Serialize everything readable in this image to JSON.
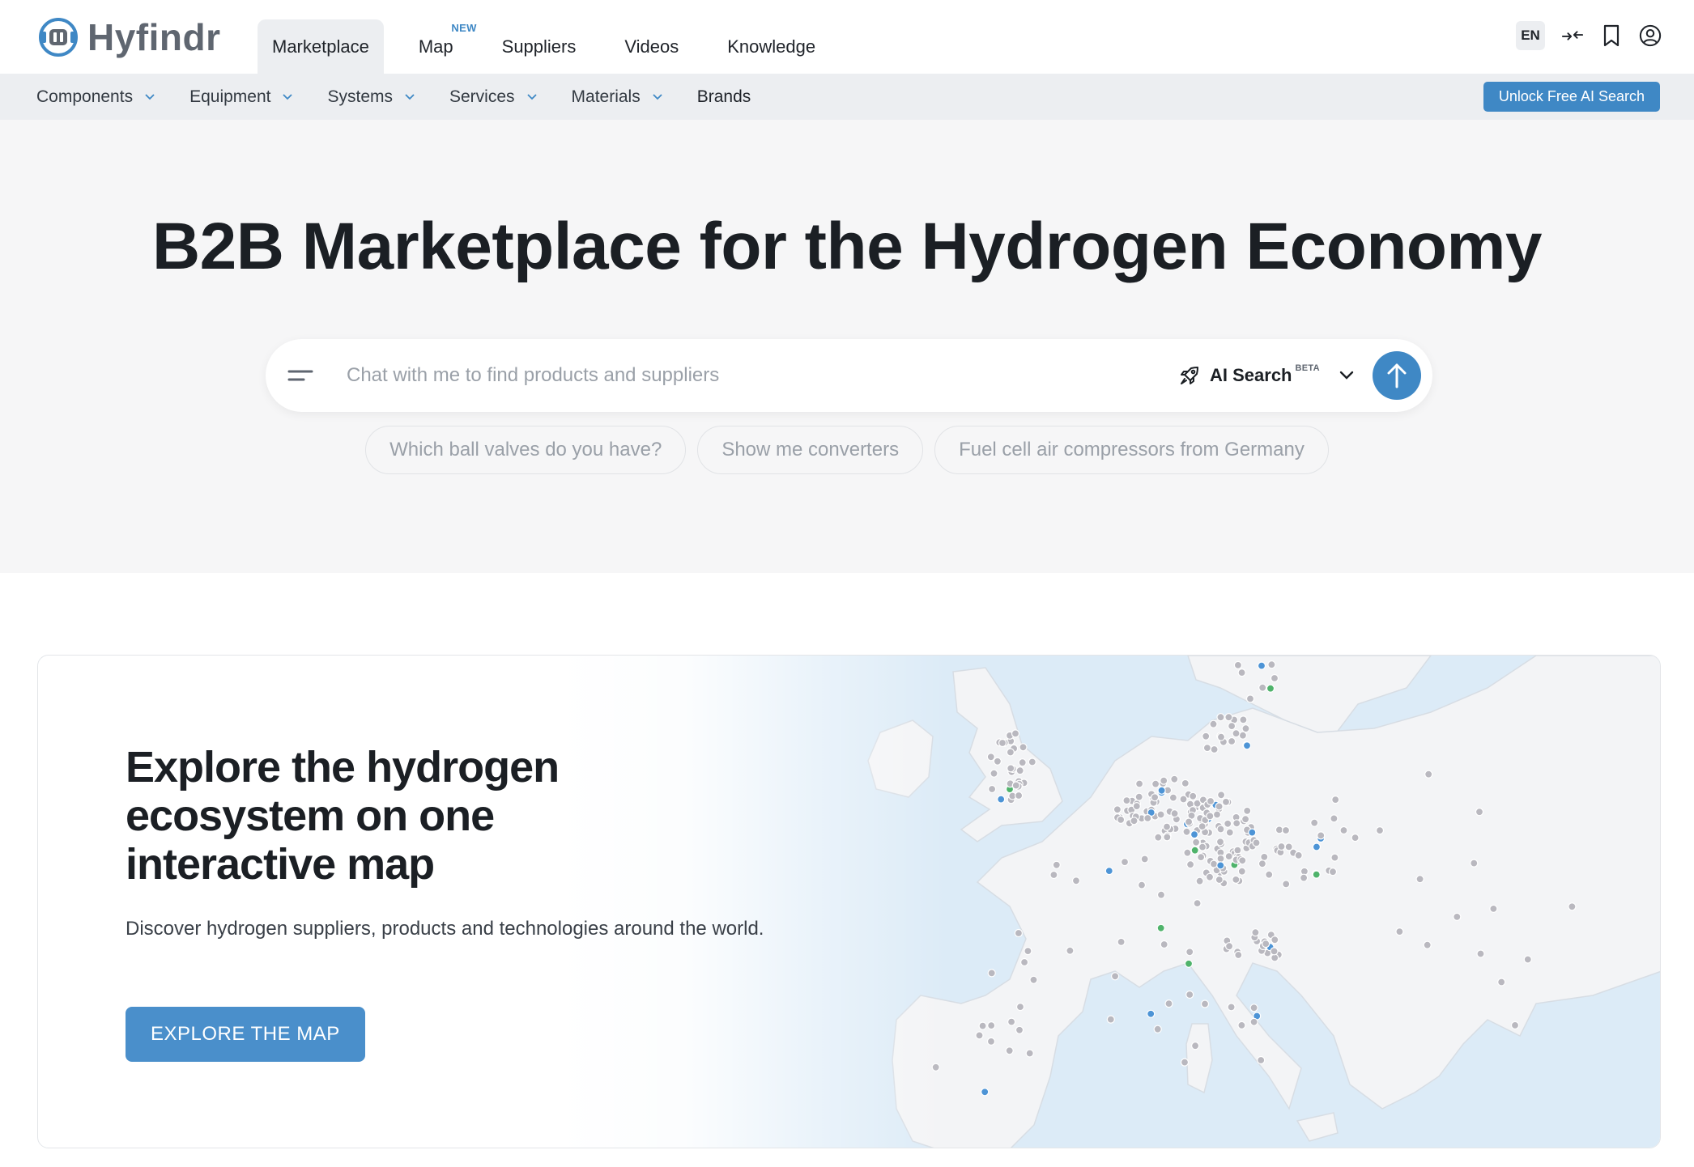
{
  "brand": {
    "name": "Hyfindr",
    "color": "#3f88c5"
  },
  "main_nav": {
    "items": [
      {
        "label": "Marketplace",
        "active": true,
        "badge": ""
      },
      {
        "label": "Map",
        "active": false,
        "badge": "NEW"
      },
      {
        "label": "Suppliers",
        "active": false,
        "badge": ""
      },
      {
        "label": "Videos",
        "active": false,
        "badge": ""
      },
      {
        "label": "Knowledge",
        "active": false,
        "badge": ""
      }
    ]
  },
  "header_tools": {
    "language": "EN",
    "icons": [
      "compare-icon",
      "bookmark-icon",
      "user-account-icon"
    ]
  },
  "category_nav": {
    "items": [
      {
        "label": "Components",
        "has_dropdown": true
      },
      {
        "label": "Equipment",
        "has_dropdown": true
      },
      {
        "label": "Systems",
        "has_dropdown": true
      },
      {
        "label": "Services",
        "has_dropdown": true
      },
      {
        "label": "Materials",
        "has_dropdown": true
      },
      {
        "label": "Brands",
        "has_dropdown": false
      }
    ],
    "cta_label": "Unlock Free AI Search"
  },
  "hero": {
    "title": "B2B Marketplace for the Hydrogen Economy",
    "search": {
      "placeholder": "Chat with me to find products and suppliers",
      "value": "",
      "mode_label": "AI Search",
      "mode_badge": "BETA"
    },
    "suggestions": [
      "Which ball valves do you have?",
      "Show me converters",
      "Fuel cell air compressors from Germany"
    ]
  },
  "map_section": {
    "title": "Explore the hydrogen ecosystem on one interactive map",
    "description": "Discover hydrogen suppliers, products and technologies around the world.",
    "button_label": "EXPLORE THE MAP"
  },
  "colors": {
    "accent": "#3f88c5",
    "hero_bg": "#f6f6f7",
    "category_bar_bg": "#eceef1",
    "map_water": "#dcebf7",
    "map_land": "#f3f4f6",
    "marker_grey": "#b9b8bf",
    "marker_blue": "#4d94d6",
    "marker_green": "#4fb36b"
  }
}
